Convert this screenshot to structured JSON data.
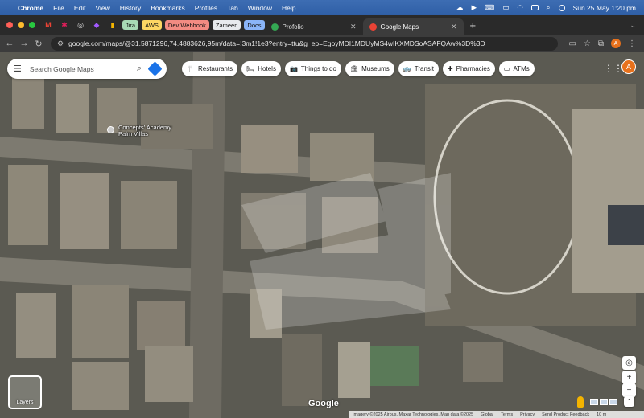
{
  "menubar": {
    "app": "Chrome",
    "menus": [
      "File",
      "Edit",
      "View",
      "History",
      "Bookmarks",
      "Profiles",
      "Tab",
      "Window",
      "Help"
    ],
    "clock": "Sun 25 May  1:20 pm"
  },
  "tabs": {
    "groups": [
      {
        "label": "Jira",
        "color": "#a8dab5"
      },
      {
        "label": "AWS",
        "color": "#fdd663"
      },
      {
        "label": "Dev Webhook",
        "color": "#f28b82"
      },
      {
        "label": "Zameen",
        "color": "#e8eaed"
      },
      {
        "label": "Docs",
        "color": "#8ab4f8"
      }
    ],
    "items": [
      {
        "title": "Profolio",
        "favicon_color": "#34a853"
      },
      {
        "title": "Google Maps",
        "favicon_color": "#ea4335"
      }
    ]
  },
  "address": {
    "url": "google.com/maps/@31.5871296,74.4883626,95m/data=!3m1!1e3?entry=ttu&g_ep=EgoyMDI1MDUyMS4wIKXMDSoASAFQAw%3D%3D"
  },
  "map": {
    "search_placeholder": "Search Google Maps",
    "chips": [
      {
        "label": "Restaurants",
        "icon": "fork-knife-icon",
        "glyph": "🍴"
      },
      {
        "label": "Hotels",
        "icon": "bed-icon",
        "glyph": "🛏"
      },
      {
        "label": "Things to do",
        "icon": "camera-icon",
        "glyph": "📷"
      },
      {
        "label": "Museums",
        "icon": "museum-icon",
        "glyph": "🏛"
      },
      {
        "label": "Transit",
        "icon": "bus-icon",
        "glyph": "🚌"
      },
      {
        "label": "Pharmacies",
        "icon": "pharmacy-icon",
        "glyph": "✚"
      },
      {
        "label": "ATMs",
        "icon": "atm-icon",
        "glyph": "▭"
      }
    ],
    "place_label_line1": "Concepts' Academy",
    "place_label_line2": "Palm Villas",
    "layers_label": "Layers",
    "logo": "Google",
    "avatar_letter": "A",
    "footer": {
      "imagery": "Imagery ©2025 Airbus, Maxar Technologies, Map data ©2025",
      "global": "Global",
      "terms": "Terms",
      "privacy": "Privacy",
      "feedback": "Send Product Feedback",
      "scale": "10 m"
    }
  },
  "colors": {
    "accent": "#1a73e8",
    "avatar": "#e8711c"
  }
}
